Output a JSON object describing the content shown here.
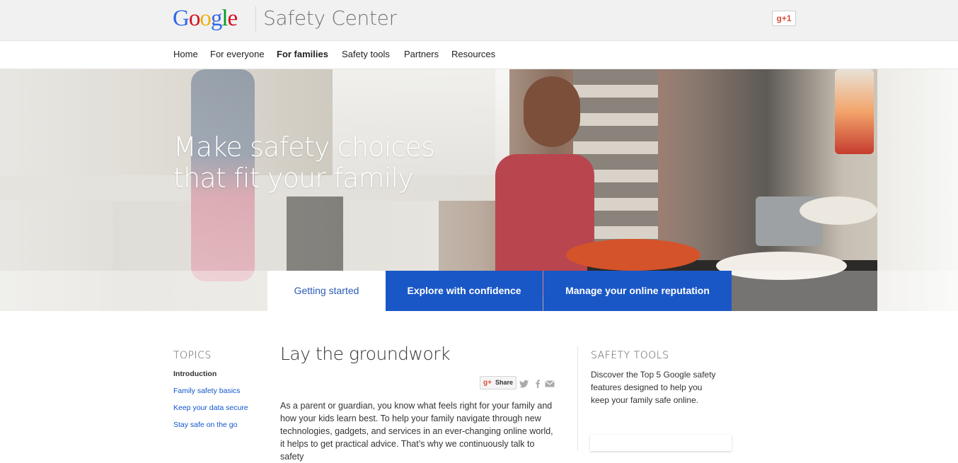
{
  "header": {
    "logo_letters": [
      {
        "ch": "G",
        "color": "#3369e8"
      },
      {
        "ch": "o",
        "color": "#d50f25"
      },
      {
        "ch": "o",
        "color": "#eeb211"
      },
      {
        "ch": "g",
        "color": "#3369e8"
      },
      {
        "ch": "l",
        "color": "#009925"
      },
      {
        "ch": "e",
        "color": "#d50f25"
      }
    ],
    "site_title": "Safety Center",
    "plus_one": "+1",
    "plus_g": "g"
  },
  "nav": {
    "items": [
      {
        "label": "Home",
        "active": false
      },
      {
        "label": "For everyone",
        "active": false
      },
      {
        "label": "For families",
        "active": true
      },
      {
        "label": "Safety tools",
        "active": false
      },
      {
        "label": "Partners",
        "active": false
      },
      {
        "label": "Resources",
        "active": false
      }
    ]
  },
  "hero": {
    "title_line1": "Make safety choices",
    "title_line2": "that fit your family"
  },
  "tabs": [
    {
      "label": "Getting started",
      "active": true
    },
    {
      "label": "Explore with confidence",
      "active": false
    },
    {
      "label": "Manage your online reputation",
      "active": false
    }
  ],
  "sidebar": {
    "heading": "TOPICS",
    "items": [
      {
        "label": "Introduction",
        "current": true
      },
      {
        "label": "Family safety basics",
        "current": false
      },
      {
        "label": "Keep your data secure",
        "current": false
      },
      {
        "label": "Stay safe on the go",
        "current": false
      }
    ]
  },
  "main": {
    "heading": "Lay the groundwork",
    "share_label": "Share",
    "share_g": "g+",
    "paragraph": "As a parent or guardian, you know what feels right for your family and how your kids learn best. To help your family navigate through new technologies, gadgets, and services in an ever-changing online world, it helps to get practical advice. That’s why we continuously talk to safety"
  },
  "safety_tools": {
    "heading": "SAFETY TOOLS",
    "text": "Discover the Top 5 Google safety features designed to help you keep your family safe online."
  },
  "accent_colors": {
    "tab_blue": "#1a57c6",
    "link_blue": "#1155cc"
  }
}
